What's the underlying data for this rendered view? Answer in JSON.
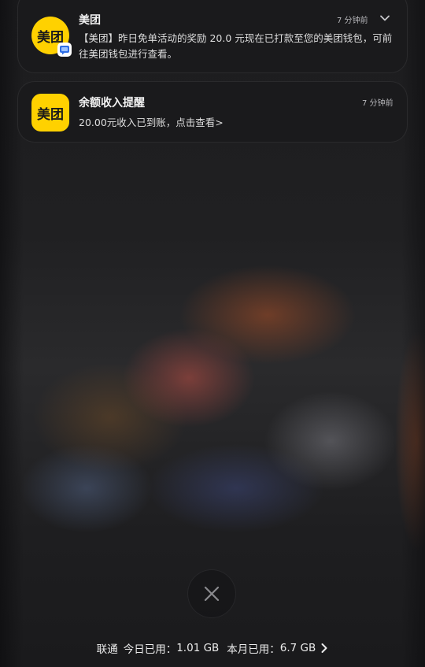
{
  "notifications": [
    {
      "app_icon_text": "美团",
      "title": "美团",
      "time": "7 分钟前",
      "body": "【美团】昨日免单活动的奖励 20.0 元现在已打款至您的美团钱包，可前往美团钱包进行查看。",
      "icon_color": "#ffd100",
      "icon_shape": "circle",
      "badge_icon": "message-app-badge-icon",
      "expand_icon": "chevron-down-icon"
    },
    {
      "app_icon_text": "美团",
      "title": "余额收入提醒",
      "time": "7 分钟前",
      "body": "20.00元收入已到账，点击查看>",
      "icon_color": "#ffd100",
      "icon_shape": "rounded-square"
    }
  ],
  "clear_button": {
    "icon": "close-icon"
  },
  "data_usage": {
    "carrier": "联通",
    "today_label": "今日已用：",
    "today_value": "1.01 GB",
    "month_label": "本月已用：",
    "month_value": "6.7 GB",
    "more_icon": "chevron-right-icon"
  }
}
